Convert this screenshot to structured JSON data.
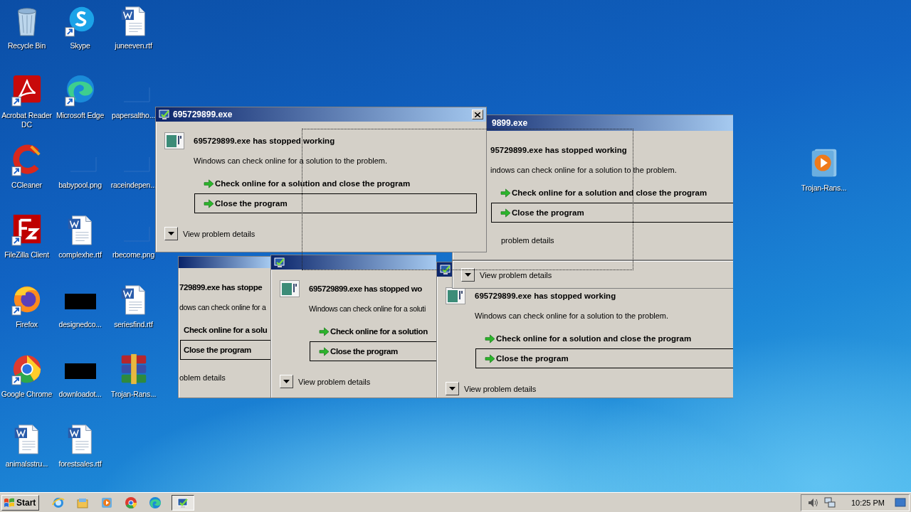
{
  "desktop_icons": [
    {
      "label": "Recycle Bin",
      "kind": "recycle",
      "shortcut": false
    },
    {
      "label": "Acrobat Reader DC",
      "kind": "acrobat",
      "shortcut": true
    },
    {
      "label": "CCleaner",
      "kind": "ccleaner",
      "shortcut": true
    },
    {
      "label": "FileZilla Client",
      "kind": "filezilla",
      "shortcut": true
    },
    {
      "label": "Firefox",
      "kind": "firefox",
      "shortcut": true
    },
    {
      "label": "Google Chrome",
      "kind": "chrome",
      "shortcut": true
    },
    {
      "label": "animalsstru...",
      "kind": "word",
      "shortcut": false
    },
    {
      "label": "Skype",
      "kind": "skype",
      "shortcut": true
    },
    {
      "label": "Microsoft Edge",
      "kind": "edge",
      "shortcut": true
    },
    {
      "label": "babypool.png",
      "kind": "blank",
      "shortcut": false
    },
    {
      "label": "complexhe.rtf",
      "kind": "word",
      "shortcut": false
    },
    {
      "label": "designedco...",
      "kind": "black",
      "shortcut": false
    },
    {
      "label": "downloadot...",
      "kind": "black",
      "shortcut": false
    },
    {
      "label": "forestsales.rtf",
      "kind": "word",
      "shortcut": false
    },
    {
      "label": "juneeven.rtf",
      "kind": "word",
      "shortcut": false
    },
    {
      "label": "papersaltho...",
      "kind": "blank",
      "shortcut": false
    },
    {
      "label": "raceindepen...",
      "kind": "blank",
      "shortcut": false
    },
    {
      "label": "rbecome.png",
      "kind": "blank",
      "shortcut": false
    },
    {
      "label": "seriesfind.rtf",
      "kind": "word",
      "shortcut": false
    },
    {
      "label": "Trojan-Rans...",
      "kind": "winrar",
      "shortcut": false
    }
  ],
  "right_icon": {
    "label": "Trojan-Rans...",
    "kind": "media",
    "shortcut": false
  },
  "dialogs": [
    {
      "title": "695729899.exe",
      "heading": "695729899.exe has stopped working",
      "message": "Windows can check online for a solution to the problem.",
      "options": [
        {
          "label": "Check online for a solution and close the program",
          "selected": false
        },
        {
          "label": "Close the program",
          "selected": true
        }
      ],
      "details": "View problem details"
    },
    {
      "title": "9899.exe",
      "heading": "95729899.exe has stopped working",
      "message": "indows can check online for a solution to the problem.",
      "options": [
        {
          "label": "Check online for a solution and close the program",
          "selected": false
        },
        {
          "label": "Close the program",
          "selected": true
        }
      ],
      "details": "problem details"
    },
    {
      "details": "View problem details"
    },
    {
      "heading": "729899.exe has stoppe",
      "message": "dows can check online for a",
      "options": [
        {
          "label": "Check online for a solu",
          "selected": false
        },
        {
          "label": "Close the program",
          "selected": true
        }
      ],
      "details": "oblem details"
    },
    {
      "heading": "695729899.exe has stopped wo",
      "message": "Windows can check online for a soluti",
      "options": [
        {
          "label": "Check online for a solution",
          "selected": false
        },
        {
          "label": "Close the program",
          "selected": true
        }
      ],
      "details": "View problem details"
    },
    {
      "heading": "695729899.exe has stopped working",
      "message": "Windows can check online for a solution to the problem.",
      "options": [
        {
          "label": "Check online for a solution and close the program",
          "selected": false
        },
        {
          "label": "Close the program",
          "selected": true
        }
      ],
      "details": "View problem details"
    }
  ],
  "taskbar": {
    "start": "Start",
    "quick_launch": [
      {
        "kind": "ie"
      },
      {
        "kind": "explorer"
      },
      {
        "kind": "media"
      },
      {
        "kind": "chrome"
      },
      {
        "kind": "edge"
      }
    ],
    "active_task": {
      "kind": "app"
    },
    "clock": "10:25 PM"
  }
}
